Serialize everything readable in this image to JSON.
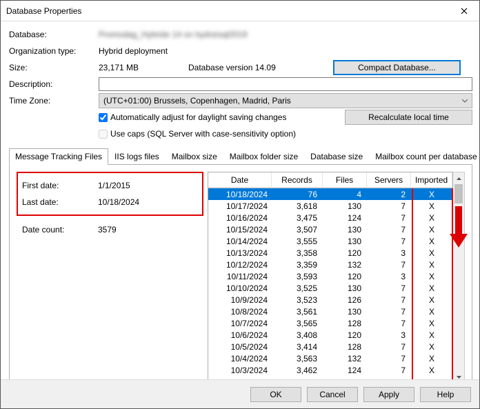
{
  "title": "Database Properties",
  "labels": {
    "database": "Database:",
    "org_type": "Organization type:",
    "size": "Size:",
    "db_version": "Database version 14.09",
    "description": "Description:",
    "timezone": "Time Zone:",
    "auto_dst": "Automatically adjust for daylight saving changes",
    "use_caps": "Use caps (SQL Server with case-sensitivity option)"
  },
  "values": {
    "database": "Promodag_Hybride 14 on hydra\\sql2019",
    "org_type": "Hybrid deployment",
    "size": "23,171 MB",
    "timezone": "(UTC+01:00) Brussels, Copenhagen, Madrid, Paris"
  },
  "buttons": {
    "compact": "Compact Database...",
    "recalc": "Recalculate local time",
    "ok": "OK",
    "cancel": "Cancel",
    "apply": "Apply",
    "help": "Help"
  },
  "tabs": [
    "Message Tracking Files",
    "IIS logs files",
    "Mailbox size",
    "Mailbox folder size",
    "Database size",
    "Mailbox count per database"
  ],
  "summary": {
    "first_date_lbl": "First date:",
    "first_date": "1/1/2015",
    "last_date_lbl": "Last date:",
    "last_date": "10/18/2024",
    "date_count_lbl": "Date count:",
    "date_count": "3579"
  },
  "grid": {
    "headers": [
      "Date",
      "Records",
      "Files",
      "Servers",
      "Imported"
    ],
    "rows": [
      {
        "date": "10/18/2024",
        "records": "76",
        "files": "4",
        "servers": "2",
        "imp": "X",
        "sel": true
      },
      {
        "date": "10/17/2024",
        "records": "3,618",
        "files": "130",
        "servers": "7",
        "imp": "X"
      },
      {
        "date": "10/16/2024",
        "records": "3,475",
        "files": "124",
        "servers": "7",
        "imp": "X"
      },
      {
        "date": "10/15/2024",
        "records": "3,507",
        "files": "130",
        "servers": "7",
        "imp": "X"
      },
      {
        "date": "10/14/2024",
        "records": "3,555",
        "files": "130",
        "servers": "7",
        "imp": "X"
      },
      {
        "date": "10/13/2024",
        "records": "3,358",
        "files": "120",
        "servers": "3",
        "imp": "X"
      },
      {
        "date": "10/12/2024",
        "records": "3,359",
        "files": "132",
        "servers": "7",
        "imp": "X"
      },
      {
        "date": "10/11/2024",
        "records": "3,593",
        "files": "120",
        "servers": "3",
        "imp": "X"
      },
      {
        "date": "10/10/2024",
        "records": "3,525",
        "files": "130",
        "servers": "7",
        "imp": "X"
      },
      {
        "date": "10/9/2024",
        "records": "3,523",
        "files": "126",
        "servers": "7",
        "imp": "X"
      },
      {
        "date": "10/8/2024",
        "records": "3,561",
        "files": "130",
        "servers": "7",
        "imp": "X"
      },
      {
        "date": "10/7/2024",
        "records": "3,565",
        "files": "128",
        "servers": "7",
        "imp": "X"
      },
      {
        "date": "10/6/2024",
        "records": "3,408",
        "files": "120",
        "servers": "3",
        "imp": "X"
      },
      {
        "date": "10/5/2024",
        "records": "3,414",
        "files": "128",
        "servers": "7",
        "imp": "X"
      },
      {
        "date": "10/4/2024",
        "records": "3,563",
        "files": "132",
        "servers": "7",
        "imp": "X"
      },
      {
        "date": "10/3/2024",
        "records": "3,462",
        "files": "124",
        "servers": "7",
        "imp": "X"
      }
    ]
  }
}
